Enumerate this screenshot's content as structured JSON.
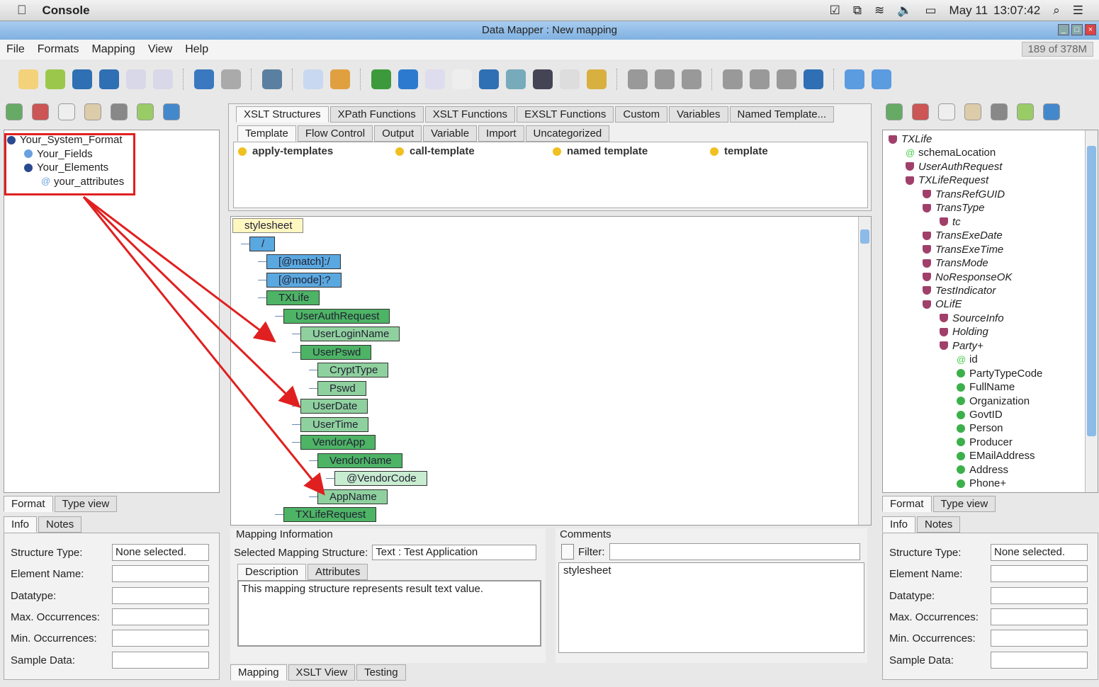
{
  "macbar": {
    "app": "Console",
    "date": "May 11",
    "time": "13:07:42"
  },
  "window": {
    "title": "Data Mapper : New mapping",
    "memory": "189 of 378M"
  },
  "menu": [
    "File",
    "Formats",
    "Mapping",
    "View",
    "Help"
  ],
  "left_tree": [
    {
      "label": "Your_System_Format",
      "depth": 0,
      "kind": "dark"
    },
    {
      "label": "Your_Fields",
      "depth": 1,
      "kind": "blue"
    },
    {
      "label": "Your_Elements",
      "depth": 1,
      "kind": "dark"
    },
    {
      "label": "your_attributes",
      "depth": 2,
      "kind": "attr"
    }
  ],
  "left_bottom": {
    "view_tabs": [
      "Format",
      "Type view"
    ],
    "info_tabs": [
      "Info",
      "Notes"
    ],
    "fields": [
      {
        "label": "Structure Type:",
        "value": "None selected."
      },
      {
        "label": "Element Name:",
        "value": ""
      },
      {
        "label": "Datatype:",
        "value": ""
      },
      {
        "label": "Max. Occurrences:",
        "value": ""
      },
      {
        "label": "Min. Occurrences:",
        "value": ""
      },
      {
        "label": "Sample Data:",
        "value": ""
      }
    ]
  },
  "palette": {
    "tabs": [
      "XSLT Structures",
      "XPath Functions",
      "XSLT Functions",
      "EXSLT Functions",
      "Custom",
      "Variables",
      "Named Template..."
    ],
    "subtabs": [
      "Template",
      "Flow Control",
      "Output",
      "Variable",
      "Import",
      "Uncategorized"
    ],
    "items": [
      "apply-templates",
      "call-template",
      "named template",
      "template"
    ]
  },
  "mapping_tree": [
    {
      "label": "stylesheet",
      "depth": 0,
      "kind": "yellow"
    },
    {
      "label": "/",
      "depth": 1,
      "kind": "blue"
    },
    {
      "label": "[@match]:/",
      "depth": 2,
      "kind": "blue"
    },
    {
      "label": "[@mode]:?",
      "depth": 2,
      "kind": "blue"
    },
    {
      "label": "TXLife",
      "depth": 2,
      "kind": "green"
    },
    {
      "label": "UserAuthRequest",
      "depth": 3,
      "kind": "green"
    },
    {
      "label": "UserLoginName",
      "depth": 4,
      "kind": "light"
    },
    {
      "label": "UserPswd",
      "depth": 4,
      "kind": "green"
    },
    {
      "label": "CryptType",
      "depth": 5,
      "kind": "light"
    },
    {
      "label": "Pswd",
      "depth": 5,
      "kind": "light"
    },
    {
      "label": "UserDate",
      "depth": 4,
      "kind": "light"
    },
    {
      "label": "UserTime",
      "depth": 4,
      "kind": "light"
    },
    {
      "label": "VendorApp",
      "depth": 4,
      "kind": "green"
    },
    {
      "label": "VendorName",
      "depth": 5,
      "kind": "green"
    },
    {
      "label": "@VendorCode",
      "depth": 6,
      "kind": "pale"
    },
    {
      "label": "AppName",
      "depth": 5,
      "kind": "light"
    },
    {
      "label": "TXLifeRequest",
      "depth": 3,
      "kind": "green"
    }
  ],
  "mapping_info": {
    "title": "Mapping Information",
    "selected_label": "Selected Mapping Structure:",
    "selected_value": "Text : Test Application",
    "tabs": [
      "Description",
      "Attributes"
    ],
    "description": "This mapping structure represents result text value."
  },
  "comments": {
    "title": "Comments",
    "filter_label": "Filter:",
    "filter_value": "",
    "items": [
      "stylesheet"
    ]
  },
  "bottom_tabs": [
    "Mapping",
    "XSLT View",
    "Testing"
  ],
  "right_tree": [
    {
      "label": "TXLife",
      "depth": 0,
      "kind": "el"
    },
    {
      "label": "schemaLocation",
      "depth": 1,
      "kind": "attr"
    },
    {
      "label": "UserAuthRequest",
      "depth": 1,
      "kind": "el"
    },
    {
      "label": "TXLifeRequest",
      "depth": 1,
      "kind": "el"
    },
    {
      "label": "TransRefGUID",
      "depth": 2,
      "kind": "el"
    },
    {
      "label": "TransType",
      "depth": 2,
      "kind": "el"
    },
    {
      "label": "tc",
      "depth": 3,
      "kind": "el"
    },
    {
      "label": "TransExeDate",
      "depth": 2,
      "kind": "el"
    },
    {
      "label": "TransExeTime",
      "depth": 2,
      "kind": "el"
    },
    {
      "label": "TransMode",
      "depth": 2,
      "kind": "el"
    },
    {
      "label": "NoResponseOK",
      "depth": 2,
      "kind": "el"
    },
    {
      "label": "TestIndicator",
      "depth": 2,
      "kind": "el"
    },
    {
      "label": "OLifE",
      "depth": 2,
      "kind": "el"
    },
    {
      "label": "SourceInfo",
      "depth": 3,
      "kind": "el"
    },
    {
      "label": "Holding",
      "depth": 3,
      "kind": "el"
    },
    {
      "label": "Party+",
      "depth": 3,
      "kind": "el"
    },
    {
      "label": "id",
      "depth": 4,
      "kind": "attr"
    },
    {
      "label": "PartyTypeCode",
      "depth": 4,
      "kind": "g"
    },
    {
      "label": "FullName",
      "depth": 4,
      "kind": "g"
    },
    {
      "label": "Organization",
      "depth": 4,
      "kind": "g"
    },
    {
      "label": "GovtID",
      "depth": 4,
      "kind": "g"
    },
    {
      "label": "Person",
      "depth": 4,
      "kind": "g"
    },
    {
      "label": "Producer",
      "depth": 4,
      "kind": "g"
    },
    {
      "label": "EMailAddress",
      "depth": 4,
      "kind": "g"
    },
    {
      "label": "Address",
      "depth": 4,
      "kind": "g"
    },
    {
      "label": "Phone+",
      "depth": 4,
      "kind": "g"
    }
  ],
  "right_bottom": {
    "view_tabs": [
      "Format",
      "Type view"
    ],
    "info_tabs": [
      "Info",
      "Notes"
    ],
    "fields": [
      {
        "label": "Structure Type:",
        "value": "None selected."
      },
      {
        "label": "Element Name:",
        "value": ""
      },
      {
        "label": "Datatype:",
        "value": ""
      },
      {
        "label": "Max. Occurrences:",
        "value": ""
      },
      {
        "label": "Min. Occurrences:",
        "value": ""
      },
      {
        "label": "Sample Data:",
        "value": ""
      }
    ]
  },
  "colors": {
    "annotation": "#e02020",
    "blue_node": "#5aa8e0",
    "green_node": "#4db365"
  }
}
